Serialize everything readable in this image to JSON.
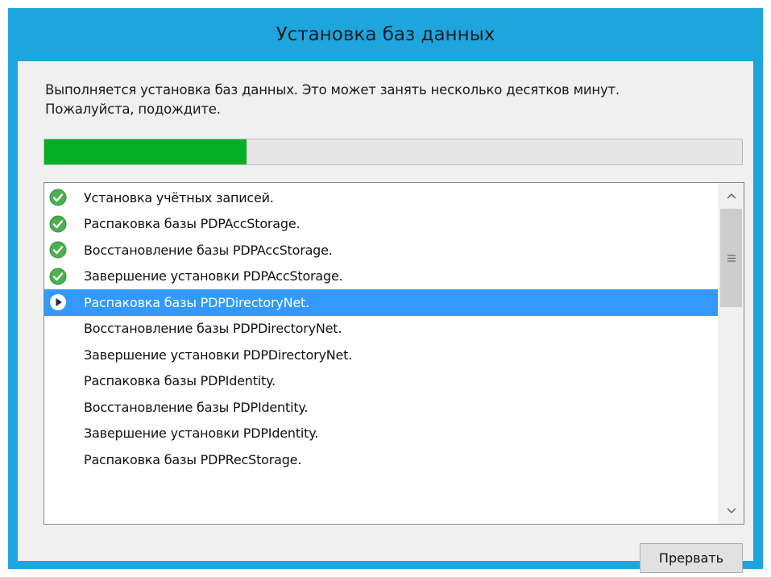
{
  "window": {
    "title": "Установка баз данных"
  },
  "message": {
    "line1": "Выполняется установка баз данных. Это может занять несколько десятков минут.",
    "line2": "Пожалуйста, подождите."
  },
  "progress": {
    "percent": 29
  },
  "steps": [
    {
      "label": "Установка учётных записей.",
      "status": "done"
    },
    {
      "label": "Распаковка базы PDPAccStorage.",
      "status": "done"
    },
    {
      "label": "Восстановление базы PDPAccStorage.",
      "status": "done"
    },
    {
      "label": "Завершение установки PDPAccStorage.",
      "status": "done"
    },
    {
      "label": "Распаковка базы PDPDirectoryNet.",
      "status": "in-progress"
    },
    {
      "label": "Восстановление базы PDPDirectoryNet.",
      "status": "pending"
    },
    {
      "label": "Завершение установки PDPDirectoryNet.",
      "status": "pending"
    },
    {
      "label": "Распаковка базы PDPIdentity.",
      "status": "pending"
    },
    {
      "label": "Восстановление базы PDPIdentity.",
      "status": "pending"
    },
    {
      "label": "Завершение установки PDPIdentity.",
      "status": "pending"
    },
    {
      "label": "Распаковка базы PDPRecStorage.",
      "status": "pending"
    }
  ],
  "buttons": {
    "abort_label": "Прервать"
  },
  "colors": {
    "title_bar": "#1fa5de",
    "progress_fill": "#06b025",
    "selection": "#3399ff",
    "check_icon": "#4caf50"
  },
  "icons": {
    "done": "check-circle-icon",
    "in_progress": "play-circle-icon",
    "scroll_up": "chevron-up-icon",
    "scroll_down": "chevron-down-icon",
    "scroll_grip": "grip-icon"
  }
}
